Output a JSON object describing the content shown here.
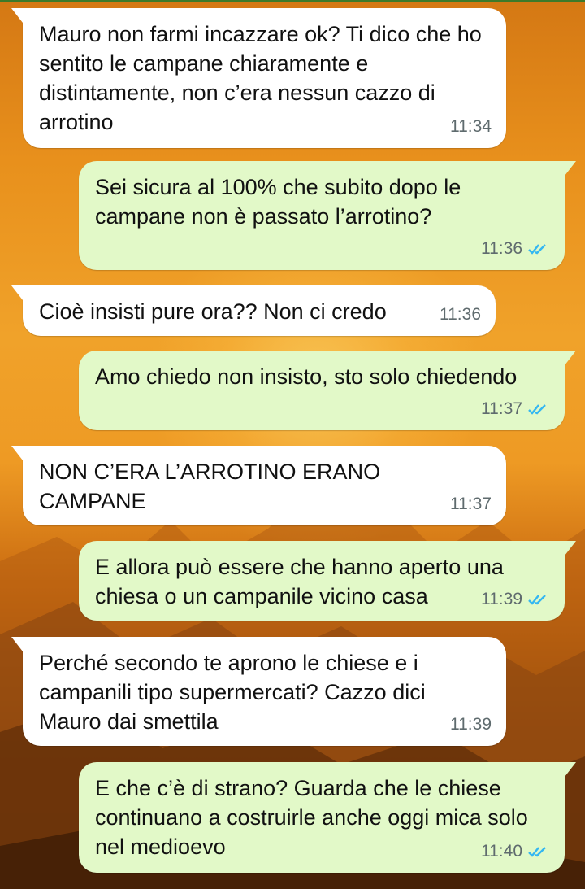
{
  "chat": {
    "messages": [
      {
        "direction": "in",
        "text": "Mauro non farmi incazzare ok? Ti dico che ho sentito le campane chiaramente e distintamente, non c’era nessun cazzo di arrotino",
        "time": "11:34"
      },
      {
        "direction": "out",
        "text": "Sei sicura al 100% che subito dopo le campane non è passato l’arrotino?",
        "time": "11:36",
        "status": "read"
      },
      {
        "direction": "in",
        "text": "Cioè insisti pure ora?? Non ci credo",
        "time": "11:36"
      },
      {
        "direction": "out",
        "text": "Amo chiedo non insisto, sto solo chiedendo",
        "time": "11:37",
        "status": "read"
      },
      {
        "direction": "in",
        "text": "NON C’ERA L’ARROTINO ERANO CAMPANE",
        "time": "11:37"
      },
      {
        "direction": "out",
        "text": "E allora può essere che hanno aperto una chiesa o un campanile vicino casa",
        "time": "11:39",
        "status": "read"
      },
      {
        "direction": "in",
        "text": "Perché secondo te aprono le chiese e i campanili tipo supermercati? Cazzo dici Mauro dai smettila",
        "time": "11:39"
      },
      {
        "direction": "out",
        "text": "E che c’è di strano? Guarda che le chiese continuano a costruirle anche oggi mica solo nel medioevo",
        "time": "11:40",
        "status": "read"
      }
    ]
  },
  "colors": {
    "incoming_bubble": "#ffffff",
    "outgoing_bubble": "#e2f9c8",
    "read_ticks": "#34b7f1",
    "timestamp": "#5f6b6e"
  },
  "icons": {
    "read_receipt": "double-check-icon"
  }
}
